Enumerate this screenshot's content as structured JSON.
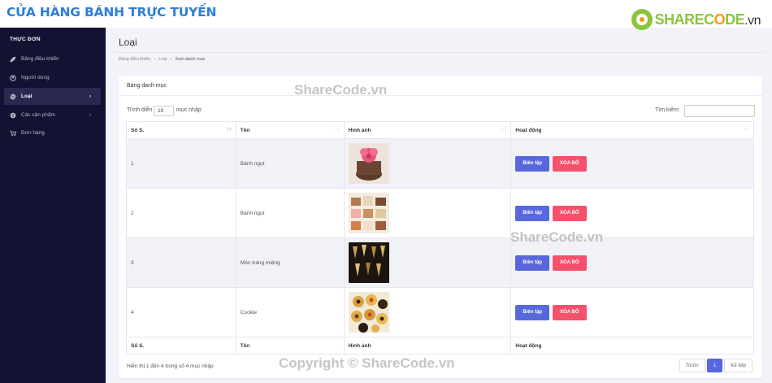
{
  "brand": "CỬA HÀNG BÁNH TRỰC TUYẾN",
  "logo": {
    "prefix": "SHAREC",
    "o": "O",
    "suffix": "DE",
    "tld": ".vn"
  },
  "sidebar": {
    "title": "THỰC ĐƠN",
    "items": [
      {
        "label": "Bảng điều khiển",
        "icon": "rocket-icon"
      },
      {
        "label": "Người dùng",
        "icon": "user-icon"
      },
      {
        "label": "Loại",
        "icon": "globe-icon"
      },
      {
        "label": "Các sản phẩm",
        "icon": "info-icon"
      },
      {
        "label": "Đơn hàng",
        "icon": "cart-icon"
      }
    ]
  },
  "page": {
    "title": "Loại"
  },
  "breadcrumb": [
    "Bảng điều khiển",
    "Loại",
    "Xem danh mục"
  ],
  "card": {
    "title": "Bảng danh mục"
  },
  "controls": {
    "show_prefix": "Trình diễn",
    "show_value": "10",
    "show_suffix": "mục nhập",
    "search_label": "Tìm kiếm:"
  },
  "table": {
    "headers": [
      "Số S.",
      "Tên",
      "Hình ảnh",
      "Hoạt động"
    ],
    "rows": [
      {
        "no": "1",
        "name": "Bánh ngọt"
      },
      {
        "no": "2",
        "name": "Bánh ngọt"
      },
      {
        "no": "3",
        "name": "Món tráng miệng"
      },
      {
        "no": "4",
        "name": "Cookie"
      }
    ],
    "edit_label": "Biên tập",
    "delete_label": "XÓA BỎ"
  },
  "footer": {
    "info": "Hiển thị 1 đến 4 trong số 4 mục nhập",
    "prev": "Trước",
    "page": "1",
    "next": "Kế tiếp"
  },
  "watermarks": [
    "ShareCode.vn",
    "ShareCode.vn",
    "Copyright © ShareCode.vn"
  ],
  "colors": {
    "brand": "#2f7ed8",
    "sidebar": "#141233",
    "edit": "#5867dd",
    "delete": "#f4516c"
  }
}
